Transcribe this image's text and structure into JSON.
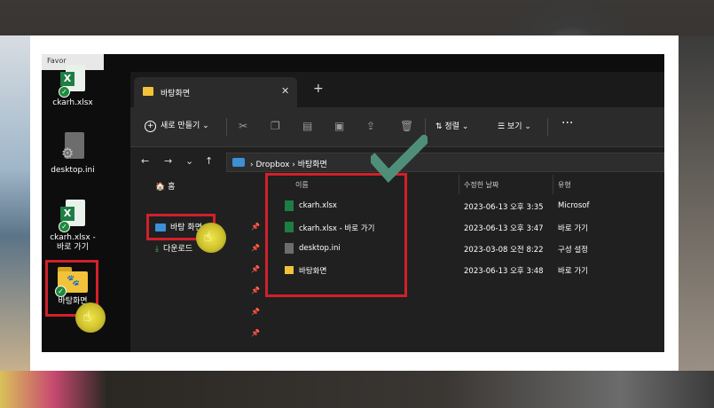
{
  "top_bar": {
    "label": "Favor"
  },
  "desktop": {
    "icons": [
      {
        "name": "ckarh.xlsx",
        "icon": "excel-icon"
      },
      {
        "name": "desktop.ini",
        "icon": "settings-file-icon"
      },
      {
        "name": "ckarh.xlsx - 바로 가기",
        "icon": "excel-shortcut-icon"
      },
      {
        "name": "바탕화면",
        "icon": "folder-icon"
      }
    ]
  },
  "explorer": {
    "tab_title": "바탕화면",
    "toolbar": {
      "new_label": "새로 만들기",
      "sort_label": "정렬",
      "view_label": "보기",
      "more_label": "···"
    },
    "address": {
      "root": "Dropbox",
      "current": "바탕화면"
    },
    "nav": {
      "home": "홈",
      "item1": "바탕 화면",
      "item2": "다운로드"
    },
    "columns": {
      "name": "이름",
      "modified": "수정한 날짜",
      "type": "유형"
    },
    "files": [
      {
        "name": "ckarh.xlsx",
        "modified": "2023-06-13 오후 3:35",
        "type": "Microsof",
        "icon": "excel-icon"
      },
      {
        "name": "ckarh.xlsx - 바로 가기",
        "modified": "2023-06-13 오후 3:47",
        "type": "바로 가기",
        "icon": "excel-shortcut-icon"
      },
      {
        "name": "desktop.ini",
        "modified": "2023-03-08 오전 8:22",
        "type": "구성 설정",
        "icon": "settings-file-icon"
      },
      {
        "name": "바탕화면",
        "modified": "2023-06-13 오후 3:48",
        "type": "바로 가기",
        "icon": "folder-icon"
      }
    ]
  },
  "colors": {
    "highlight": "#d2202a",
    "check": "#4f8f7a",
    "cursor": "#e6d93a"
  }
}
